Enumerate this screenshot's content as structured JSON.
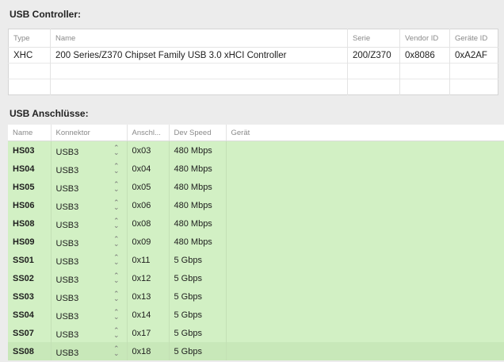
{
  "controller_section": {
    "title": "USB Controller:",
    "columns": [
      "Type",
      "Name",
      "Serie",
      "Vendor ID",
      "Geräte ID"
    ],
    "rows": [
      {
        "type": "XHC",
        "name": "200 Series/Z370 Chipset Family USB 3.0 xHCI Controller",
        "serie": "200/Z370",
        "vendor_id": "0x8086",
        "device_id": "0xA2AF"
      }
    ]
  },
  "ports_section": {
    "title": "USB Anschlüsse:",
    "columns": [
      "Name",
      "Konnektor",
      "Anschl...",
      "Dev Speed",
      "Gerät"
    ],
    "row_color": "#d2f0c4",
    "rows": [
      {
        "name": "HS03",
        "connector": "USB3",
        "port": "0x03",
        "speed": "480 Mbps",
        "device": ""
      },
      {
        "name": "HS04",
        "connector": "USB3",
        "port": "0x04",
        "speed": "480 Mbps",
        "device": ""
      },
      {
        "name": "HS05",
        "connector": "USB3",
        "port": "0x05",
        "speed": "480 Mbps",
        "device": ""
      },
      {
        "name": "HS06",
        "connector": "USB3",
        "port": "0x06",
        "speed": "480 Mbps",
        "device": ""
      },
      {
        "name": "HS08",
        "connector": "USB3",
        "port": "0x08",
        "speed": "480 Mbps",
        "device": ""
      },
      {
        "name": "HS09",
        "connector": "USB3",
        "port": "0x09",
        "speed": "480 Mbps",
        "device": ""
      },
      {
        "name": "SS01",
        "connector": "USB3",
        "port": "0x11",
        "speed": "5 Gbps",
        "device": ""
      },
      {
        "name": "SS02",
        "connector": "USB3",
        "port": "0x12",
        "speed": "5 Gbps",
        "device": ""
      },
      {
        "name": "SS03",
        "connector": "USB3",
        "port": "0x13",
        "speed": "5 Gbps",
        "device": ""
      },
      {
        "name": "SS04",
        "connector": "USB3",
        "port": "0x14",
        "speed": "5 Gbps",
        "device": ""
      },
      {
        "name": "SS07",
        "connector": "USB3",
        "port": "0x17",
        "speed": "5 Gbps",
        "device": ""
      },
      {
        "name": "SS08",
        "connector": "USB3",
        "port": "0x18",
        "speed": "5 Gbps",
        "device": ""
      }
    ]
  }
}
